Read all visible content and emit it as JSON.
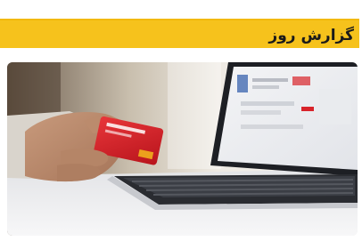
{
  "section_title": "گزارش روز",
  "photo": {
    "subject": "hand-holding-credit-card-laptop-photo",
    "card_color": "#d8232a",
    "accent_color": "#f6c21c"
  }
}
